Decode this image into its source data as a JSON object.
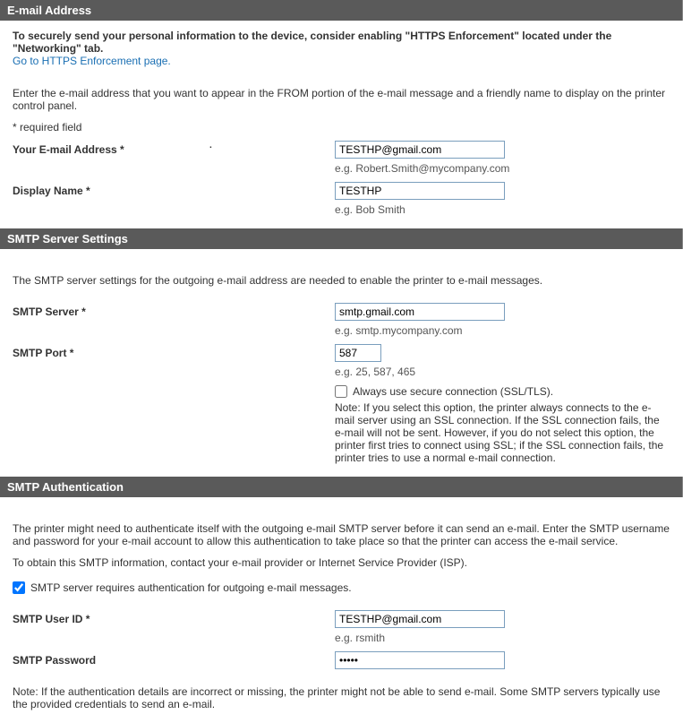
{
  "email_section": {
    "header": "E-mail Address",
    "intro": "To securely send your personal information to the device, consider enabling \"HTTPS Enforcement\" located under the \"Networking\" tab.",
    "https_link": "Go to HTTPS Enforcement page.",
    "description": "Enter the e-mail address that you want to appear in the FROM portion of the e-mail message and a friendly name to display on the printer control panel.",
    "required_note": "* required field",
    "email_label": "Your E-mail Address *",
    "email_value": "TESTHP@gmail.com",
    "email_example": "e.g. Robert.Smith@mycompany.com",
    "display_label": "Display Name *",
    "display_value": "TESTHP",
    "display_example": "e.g. Bob Smith"
  },
  "smtp_section": {
    "header": "SMTP Server Settings",
    "description": "The SMTP server settings for the outgoing e-mail address are needed to enable the printer to e-mail messages.",
    "server_label": "SMTP Server *",
    "server_value": "smtp.gmail.com",
    "server_example": "e.g. smtp.mycompany.com",
    "port_label": "SMTP Port *",
    "port_value": "587",
    "port_example": "e.g. 25, 587, 465",
    "ssl_label": "Always use secure connection (SSL/TLS).",
    "ssl_checked": false,
    "ssl_note": "Note: If you select this option, the printer always connects to the e-mail server using an SSL connection. If the SSL connection fails, the e-mail will not be sent. However, if you do not select this option, the printer first tries to connect using SSL; if the SSL connection fails, the printer tries to use a normal e-mail connection."
  },
  "auth_section": {
    "header": "SMTP Authentication",
    "description": "The printer might need to authenticate itself with the outgoing e-mail SMTP server before it can send an e-mail. Enter the SMTP username and password for your e-mail account to allow this authentication to take place so that the printer can access the e-mail service.",
    "obtain_info": "To obtain this SMTP information, contact your e-mail provider or Internet Service Provider (ISP).",
    "auth_required_label": "SMTP server requires authentication for outgoing e-mail messages.",
    "auth_required_checked": true,
    "user_label": "SMTP User ID *",
    "user_value": "TESTHP@gmail.com",
    "user_example": "e.g. rsmith",
    "pass_label": "SMTP Password",
    "pass_value": "•••••",
    "auth_note": "Note: If the authentication details are incorrect or missing, the printer might not be able to send e-mail. Some SMTP servers typically use the provided credentials to send an e-mail."
  }
}
